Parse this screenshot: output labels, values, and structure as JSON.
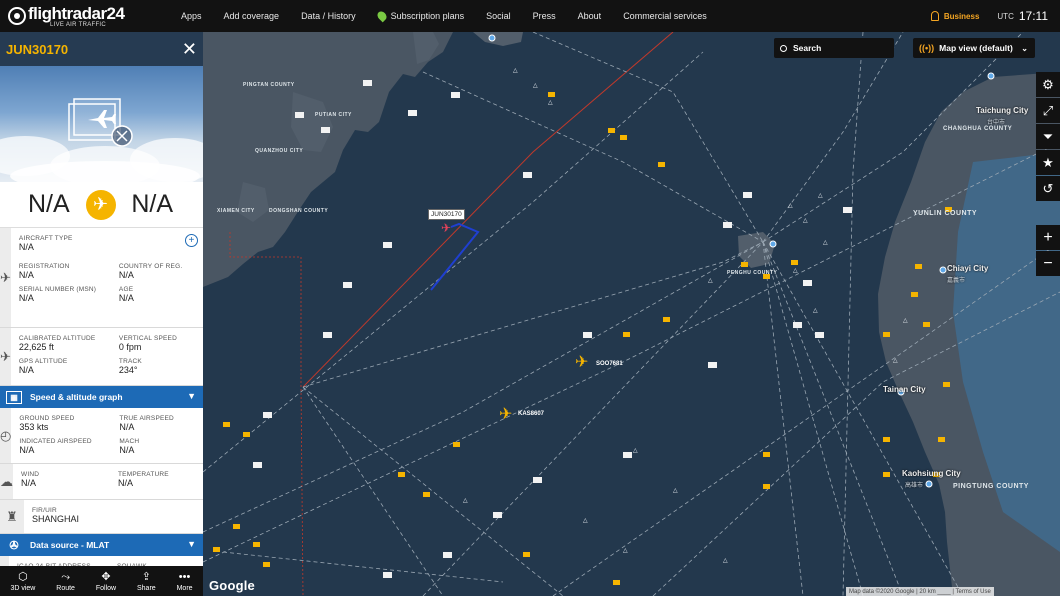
{
  "header": {
    "logo_text": "flightradar24",
    "logo_tagline": "LIVE AIR TRAFFIC",
    "nav": [
      "Apps",
      "Add coverage",
      "Data / History",
      "Subscription plans",
      "Social",
      "Press",
      "About",
      "Commercial services"
    ],
    "account_label": "Business",
    "tz_label": "UTC",
    "clock": "17:11"
  },
  "panel": {
    "callsign": "JUN30170",
    "origin": "N/A",
    "destination": "N/A",
    "aircraft_type_label": "AIRCRAFT TYPE",
    "aircraft_type": "N/A",
    "registration_label": "REGISTRATION",
    "registration": "N/A",
    "country_label": "COUNTRY OF REG.",
    "country": "N/A",
    "msn_label": "SERIAL NUMBER (MSN)",
    "msn": "N/A",
    "age_label": "AGE",
    "age": "N/A",
    "cal_alt_label": "CALIBRATED ALTITUDE",
    "cal_alt": "22,625 ft",
    "vs_label": "VERTICAL SPEED",
    "vs": "0 fpm",
    "gps_alt_label": "GPS ALTITUDE",
    "gps_alt": "N/A",
    "track_label": "TRACK",
    "track": "234°",
    "speed_graph": "Speed & altitude graph",
    "gs_label": "GROUND SPEED",
    "gs": "353 kts",
    "tas_label": "TRUE AIRSPEED",
    "tas": "N/A",
    "ias_label": "INDICATED AIRSPEED",
    "ias": "N/A",
    "mach_label": "MACH",
    "mach": "N/A",
    "wind_label": "WIND",
    "wind": "N/A",
    "temp_label": "TEMPERATURE",
    "temp": "N/A",
    "fir_label": "FIR/UIR",
    "fir": "SHANGHAI",
    "data_source": "Data source - MLAT",
    "icao_label": "ICAO 24-BIT ADDRESS",
    "squawk_label": "SQUAWK"
  },
  "bottom_bar": [
    "3D view",
    "Route",
    "Follow",
    "Share",
    "More"
  ],
  "map": {
    "search_label": "Search",
    "map_view_label": "Map view (default)",
    "google": "Google",
    "attribution": "Map data ©2020 Google  |  20 km ____  |  Terms of Use",
    "selected_label": "JUN30170",
    "aircraft_labels": [
      "SOO7681",
      "KAS8607"
    ],
    "places": {
      "taichung_city": "Taichung City",
      "taichung_city_zh": "台中市",
      "yunlin": "YUNLIN COUNTY",
      "chiayi": "Chiayi City",
      "chiayi_zh": "嘉義市",
      "tainan": "Tainan City",
      "kaohsiung": "Kaohsiung City",
      "kaohsiung_zh": "高雄市",
      "pingtung": "PINGTUNG COUNTY",
      "changhua": "CHANGHUA COUNTY",
      "fujian1": "PINGTAN COUNTY",
      "fujian2": "PUTIAN CITY",
      "fujian3": "QUANZHOU CITY",
      "fujian4": "XIAMEN CITY",
      "fujian5": "DONGSHAN COUNTY",
      "penghu": "PENGHU COUNTY"
    }
  }
}
